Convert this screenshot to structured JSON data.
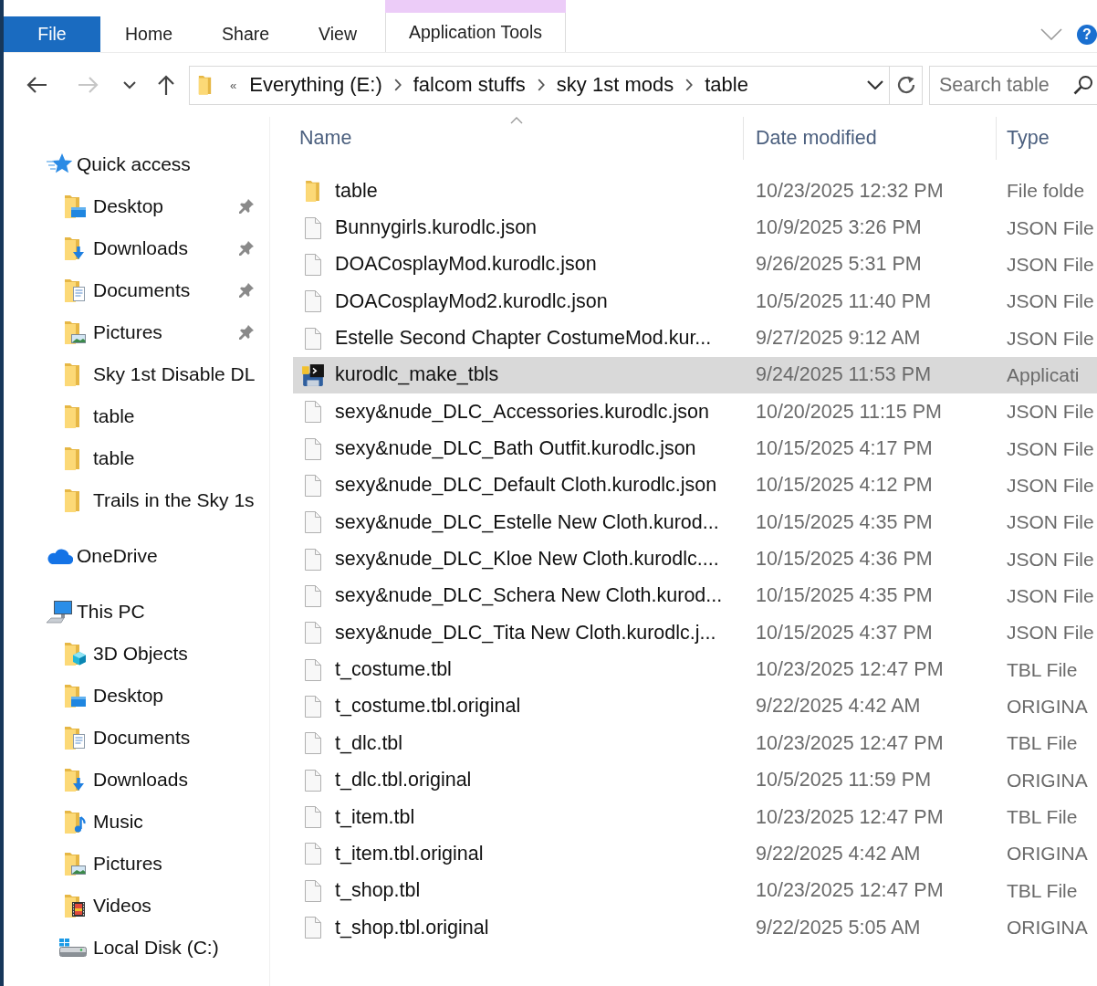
{
  "ribbon": {
    "tabs": [
      {
        "label": "File",
        "kind": "file"
      },
      {
        "label": "Home",
        "kind": "tab"
      },
      {
        "label": "Share",
        "kind": "tab"
      },
      {
        "label": "View",
        "kind": "tab"
      },
      {
        "label": "Application Tools",
        "kind": "contextual"
      }
    ],
    "help": "?"
  },
  "navigation": {
    "buttons": [
      {
        "kind": "back",
        "disabled": false
      },
      {
        "kind": "forward",
        "disabled": true
      },
      {
        "kind": "recent",
        "disabled": false
      },
      {
        "kind": "up",
        "disabled": false
      }
    ]
  },
  "address_bar": {
    "overflow": "«",
    "path": [
      "Everything (E:)",
      "falcom stuffs",
      "sky 1st mods",
      "table"
    ]
  },
  "search": {
    "placeholder": "Search table"
  },
  "sidebar": {
    "items": [
      {
        "label": "Quick access",
        "kind": "star",
        "children": [
          {
            "label": "Desktop",
            "kind": "desktop",
            "pinned": true
          },
          {
            "label": "Downloads",
            "kind": "downloads",
            "pinned": true
          },
          {
            "label": "Documents",
            "kind": "documents",
            "pinned": true
          },
          {
            "label": "Pictures",
            "kind": "pictures",
            "pinned": true
          },
          {
            "label": "Sky 1st Disable DL",
            "kind": "folder",
            "pinned": false
          },
          {
            "label": "table",
            "kind": "folder",
            "pinned": false
          },
          {
            "label": "table",
            "kind": "folder",
            "pinned": false
          },
          {
            "label": "Trails in the Sky 1s",
            "kind": "folder",
            "pinned": false
          }
        ]
      },
      {
        "label": "OneDrive",
        "kind": "cloud"
      },
      {
        "label": "This PC",
        "kind": "pc",
        "children": [
          {
            "label": "3D Objects",
            "kind": "objects3d"
          },
          {
            "label": "Desktop",
            "kind": "desktop"
          },
          {
            "label": "Documents",
            "kind": "documents"
          },
          {
            "label": "Downloads",
            "kind": "downloads"
          },
          {
            "label": "Music",
            "kind": "music"
          },
          {
            "label": "Pictures",
            "kind": "pictures"
          },
          {
            "label": "Videos",
            "kind": "videos"
          },
          {
            "label": "Local Disk (C:)",
            "kind": "drive"
          }
        ]
      }
    ]
  },
  "file_list": {
    "columns": [
      {
        "label": "Name",
        "sorted": true
      },
      {
        "label": "Date modified",
        "sorted": false
      },
      {
        "label": "Type",
        "sorted": false
      }
    ],
    "rows": [
      {
        "name": "table",
        "date": "10/23/2025 12:32 PM",
        "type": "File folde",
        "kind": "folder",
        "selected": false
      },
      {
        "name": "Bunnygirls.kurodlc.json",
        "date": "10/9/2025 3:26 PM",
        "type": "JSON File",
        "kind": "file",
        "selected": false
      },
      {
        "name": "DOACosplayMod.kurodlc.json",
        "date": "9/26/2025 5:31 PM",
        "type": "JSON File",
        "kind": "file",
        "selected": false
      },
      {
        "name": "DOACosplayMod2.kurodlc.json",
        "date": "10/5/2025 11:40 PM",
        "type": "JSON File",
        "kind": "file",
        "selected": false
      },
      {
        "name": "Estelle Second Chapter CostumeMod.kur...",
        "date": "9/27/2025 9:12 AM",
        "type": "JSON File",
        "kind": "file",
        "selected": false
      },
      {
        "name": "kurodlc_make_tbls",
        "date": "9/24/2025 11:53 PM",
        "type": "Applicati",
        "kind": "app",
        "selected": true
      },
      {
        "name": "sexy&nude_DLC_Accessories.kurodlc.json",
        "date": "10/20/2025 11:15 PM",
        "type": "JSON File",
        "kind": "file",
        "selected": false
      },
      {
        "name": "sexy&nude_DLC_Bath Outfit.kurodlc.json",
        "date": "10/15/2025 4:17 PM",
        "type": "JSON File",
        "kind": "file",
        "selected": false
      },
      {
        "name": "sexy&nude_DLC_Default Cloth.kurodlc.json",
        "date": "10/15/2025 4:12 PM",
        "type": "JSON File",
        "kind": "file",
        "selected": false
      },
      {
        "name": "sexy&nude_DLC_Estelle New Cloth.kurod...",
        "date": "10/15/2025 4:35 PM",
        "type": "JSON File",
        "kind": "file",
        "selected": false
      },
      {
        "name": "sexy&nude_DLC_Kloe New Cloth.kurodlc....",
        "date": "10/15/2025 4:36 PM",
        "type": "JSON File",
        "kind": "file",
        "selected": false
      },
      {
        "name": "sexy&nude_DLC_Schera New Cloth.kurod...",
        "date": "10/15/2025 4:35 PM",
        "type": "JSON File",
        "kind": "file",
        "selected": false
      },
      {
        "name": "sexy&nude_DLC_Tita New Cloth.kurodlc.j...",
        "date": "10/15/2025 4:37 PM",
        "type": "JSON File",
        "kind": "file",
        "selected": false
      },
      {
        "name": "t_costume.tbl",
        "date": "10/23/2025 12:47 PM",
        "type": "TBL File",
        "kind": "file",
        "selected": false
      },
      {
        "name": "t_costume.tbl.original",
        "date": "9/22/2025 4:42 AM",
        "type": "ORIGINA",
        "kind": "file",
        "selected": false
      },
      {
        "name": "t_dlc.tbl",
        "date": "10/23/2025 12:47 PM",
        "type": "TBL File",
        "kind": "file",
        "selected": false
      },
      {
        "name": "t_dlc.tbl.original",
        "date": "10/5/2025 11:59 PM",
        "type": "ORIGINA",
        "kind": "file",
        "selected": false
      },
      {
        "name": "t_item.tbl",
        "date": "10/23/2025 12:47 PM",
        "type": "TBL File",
        "kind": "file",
        "selected": false
      },
      {
        "name": "t_item.tbl.original",
        "date": "9/22/2025 4:42 AM",
        "type": "ORIGINA",
        "kind": "file",
        "selected": false
      },
      {
        "name": "t_shop.tbl",
        "date": "10/23/2025 12:47 PM",
        "type": "TBL File",
        "kind": "file",
        "selected": false
      },
      {
        "name": "t_shop.tbl.original",
        "date": "9/22/2025 5:05 AM",
        "type": "ORIGINA",
        "kind": "file",
        "selected": false
      }
    ]
  }
}
